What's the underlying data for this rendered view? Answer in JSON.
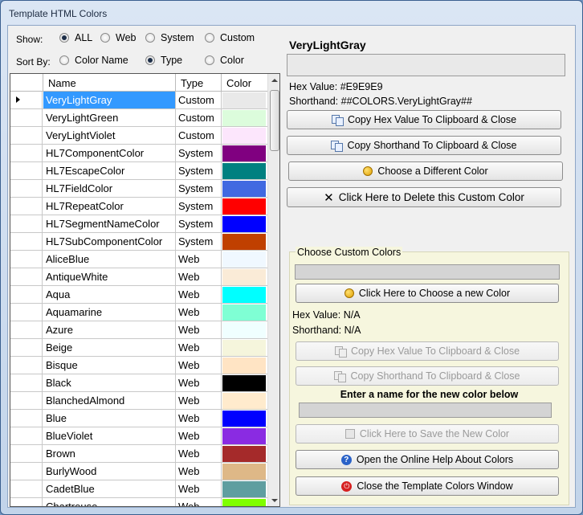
{
  "window": {
    "title": "Template HTML Colors"
  },
  "filters": {
    "show_label": "Show:",
    "show_options": [
      {
        "label": "ALL",
        "selected": true
      },
      {
        "label": "Web",
        "selected": false
      },
      {
        "label": "System",
        "selected": false
      },
      {
        "label": "Custom",
        "selected": false
      }
    ],
    "sort_label": "Sort By:",
    "sort_options": [
      {
        "label": "Color Name",
        "selected": false
      },
      {
        "label": "Type",
        "selected": true
      },
      {
        "label": "Color",
        "selected": false
      }
    ]
  },
  "grid": {
    "columns": [
      "Name",
      "Type",
      "Color"
    ],
    "rows": [
      {
        "name": "VeryLightGray",
        "type": "Custom",
        "color": "#E9E9E9",
        "selected": true
      },
      {
        "name": "VeryLightGreen",
        "type": "Custom",
        "color": "#DCFCDC"
      },
      {
        "name": "VeryLightViolet",
        "type": "Custom",
        "color": "#FCE6FC"
      },
      {
        "name": "HL7ComponentColor",
        "type": "System",
        "color": "#800080"
      },
      {
        "name": "HL7EscapeColor",
        "type": "System",
        "color": "#008080"
      },
      {
        "name": "HL7FieldColor",
        "type": "System",
        "color": "#4169E1"
      },
      {
        "name": "HL7RepeatColor",
        "type": "System",
        "color": "#FF0000"
      },
      {
        "name": "HL7SegmentNameColor",
        "type": "System",
        "color": "#0000FF"
      },
      {
        "name": "HL7SubComponentColor",
        "type": "System",
        "color": "#C04000"
      },
      {
        "name": "AliceBlue",
        "type": "Web",
        "color": "#F0F8FF"
      },
      {
        "name": "AntiqueWhite",
        "type": "Web",
        "color": "#FAEBD7"
      },
      {
        "name": "Aqua",
        "type": "Web",
        "color": "#00FFFF"
      },
      {
        "name": "Aquamarine",
        "type": "Web",
        "color": "#7FFFD4"
      },
      {
        "name": "Azure",
        "type": "Web",
        "color": "#F0FFFF"
      },
      {
        "name": "Beige",
        "type": "Web",
        "color": "#F5F5DC"
      },
      {
        "name": "Bisque",
        "type": "Web",
        "color": "#FFE4C4"
      },
      {
        "name": "Black",
        "type": "Web",
        "color": "#000000"
      },
      {
        "name": "BlanchedAlmond",
        "type": "Web",
        "color": "#FFEBCD"
      },
      {
        "name": "Blue",
        "type": "Web",
        "color": "#0000FF"
      },
      {
        "name": "BlueViolet",
        "type": "Web",
        "color": "#8A2BE2"
      },
      {
        "name": "Brown",
        "type": "Web",
        "color": "#A52A2A"
      },
      {
        "name": "BurlyWood",
        "type": "Web",
        "color": "#DEB887"
      },
      {
        "name": "CadetBlue",
        "type": "Web",
        "color": "#5F9EA0"
      },
      {
        "name": "Chartreuse",
        "type": "Web",
        "color": "#7FFF00"
      }
    ]
  },
  "selected": {
    "name": "VeryLightGray",
    "color": "#E9E9E9",
    "hex_label": "Hex Value:",
    "hex_value": "#E9E9E9",
    "shorthand_label": "Shorthand:",
    "shorthand_value": "##COLORS.VeryLightGray##"
  },
  "actions": {
    "copy_hex": "Copy Hex Value To Clipboard & Close",
    "copy_shorthand": "Copy Shorthand To Clipboard & Close",
    "choose_different": "Choose a Different Color",
    "delete_custom": "Click Here to Delete this Custom Color"
  },
  "custom": {
    "group_title": "Choose Custom Colors",
    "choose_new": "Click Here to Choose a new Color",
    "hex_label": "Hex Value:",
    "hex_value": "N/A",
    "shorthand_label": "Shorthand:",
    "shorthand_value": "N/A",
    "copy_hex": "Copy Hex Value To Clipboard & Close",
    "copy_shorthand": "Copy Shorthand To Clipboard & Close",
    "name_prompt": "Enter a name for the new color below",
    "name_value": "",
    "save": "Click Here to Save the New Color",
    "help": "Open the Online Help About Colors",
    "close": "Close the Template Colors Window"
  }
}
